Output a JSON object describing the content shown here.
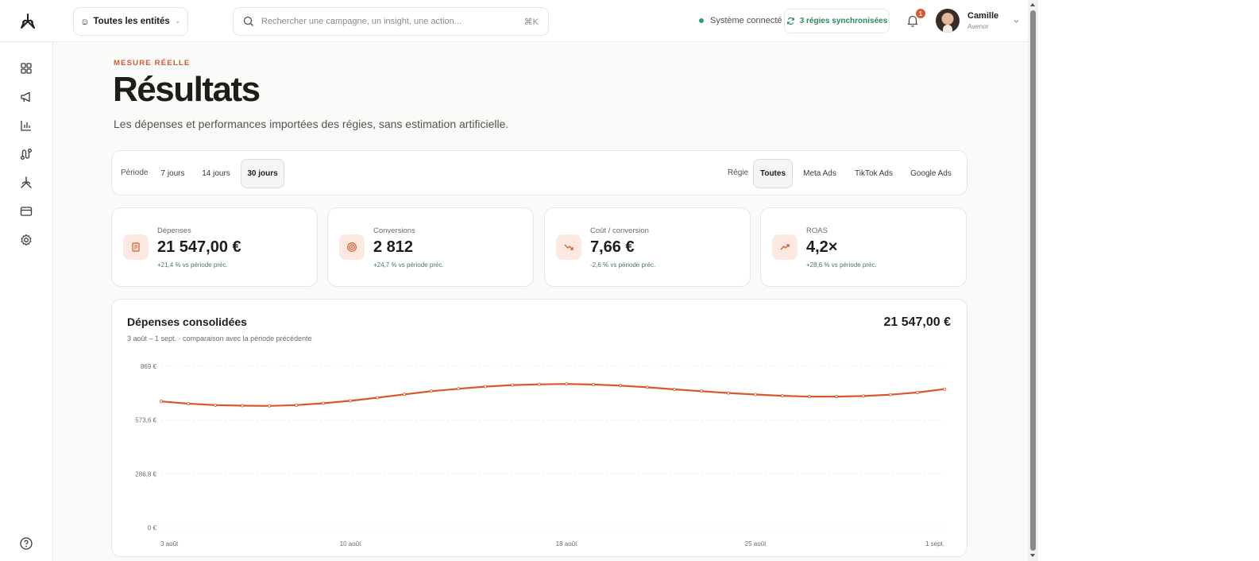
{
  "topbar": {
    "entity_select": "Toutes les entités",
    "search_placeholder": "Rechercher une campagne, un insight, une action...",
    "search_shortcut": "⌘K",
    "system_status": "Système connecté",
    "sync_label": "3 régies synchronisées",
    "notifications_count": "1",
    "user_name": "Camille",
    "user_org": "Avenor"
  },
  "sidebar": {
    "items": [
      "grid-icon",
      "megaphone-icon",
      "bar-chart-icon",
      "route-icon",
      "brand-icon",
      "card-icon",
      "settings-icon"
    ],
    "help": "help-icon"
  },
  "page": {
    "eyebrow": "MESURE RÉELLE",
    "title": "Résultats",
    "subtitle": "Les dépenses et performances importées des régies, sans estimation artificielle."
  },
  "filters": {
    "period_label": "Période",
    "periods": [
      "7 jours",
      "14 jours",
      "30 jours"
    ],
    "period_selected": "30 jours",
    "regie_label": "Régie",
    "regies": [
      "Toutes",
      "Meta Ads",
      "TikTok Ads",
      "Google Ads"
    ],
    "regie_selected": "Toutes"
  },
  "kpis": [
    {
      "label": "Dépenses",
      "value": "21 547,00 €",
      "delta": "+21,4 % vs période préc.",
      "icon": "receipt-icon"
    },
    {
      "label": "Conversions",
      "value": "2 812",
      "delta": "+24,7 % vs période préc.",
      "icon": "target-icon"
    },
    {
      "label": "Coût / conversion",
      "value": "7,66 €",
      "delta": "-2,6 % vs période préc.",
      "icon": "trend-down-icon"
    },
    {
      "label": "ROAS",
      "value": "4,2×",
      "delta": "+28,6 % vs période préc.",
      "icon": "trend-up-icon"
    }
  ],
  "chart": {
    "title": "Dépenses consolidées",
    "subtitle": "3 août – 1 sept. · comparaison avec la période précédente",
    "total": "21 547,00 €"
  },
  "chart_data": {
    "type": "line",
    "title": "Dépenses consolidées",
    "xlabel": "",
    "ylabel": "",
    "ylim": [
      0,
      869
    ],
    "y_ticks": [
      "0 €",
      "286,8 €",
      "573,6 €",
      "869 €"
    ],
    "x_ticks": [
      "3 août",
      "10 août",
      "18 août",
      "25 août",
      "1 sept."
    ],
    "color": "#d9572b",
    "grid": true,
    "x": [
      "3 août",
      "4 août",
      "5 août",
      "6 août",
      "7 août",
      "8 août",
      "9 août",
      "10 août",
      "11 août",
      "12 août",
      "13 août",
      "14 août",
      "15 août",
      "16 août",
      "17 août",
      "18 août",
      "19 août",
      "20 août",
      "21 août",
      "22 août",
      "23 août",
      "24 août",
      "25 août",
      "26 août",
      "27 août",
      "28 août",
      "29 août",
      "30 août",
      "31 août",
      "1 sept."
    ],
    "values": [
      680,
      668,
      660,
      657,
      656,
      660,
      670,
      683,
      700,
      718,
      735,
      748,
      760,
      768,
      772,
      774,
      771,
      765,
      756,
      745,
      735,
      725,
      717,
      710,
      706,
      706,
      709,
      716,
      728,
      746
    ]
  }
}
